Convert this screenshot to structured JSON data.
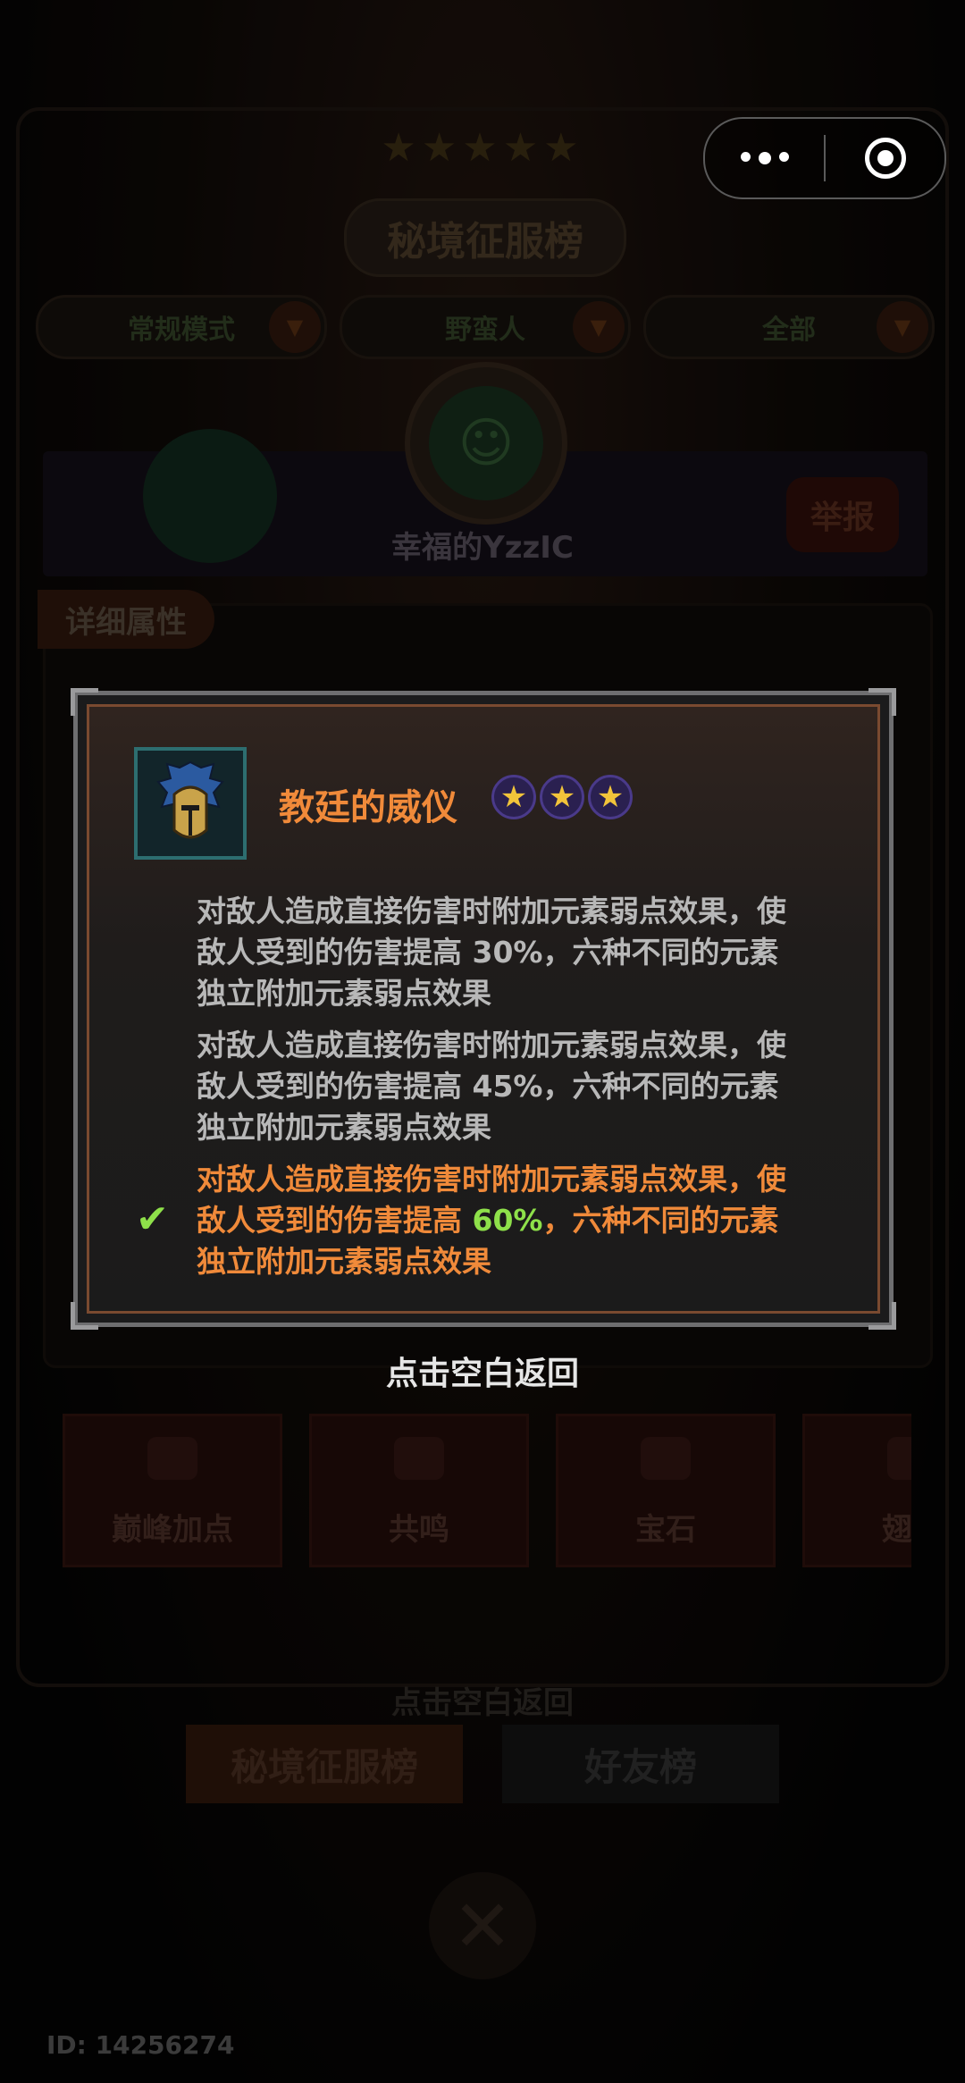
{
  "capsule": {
    "more_icon": "more-dots-icon",
    "close_icon": "target-circle-icon"
  },
  "header": {
    "title": "秘境征服榜",
    "filters": [
      {
        "label": "常规模式"
      },
      {
        "label": "野蛮人"
      },
      {
        "label": "全部"
      }
    ]
  },
  "player": {
    "name": "幸福的YzzIC",
    "report_label": "举报"
  },
  "detail": {
    "tab_label": "详细属性"
  },
  "features": [
    {
      "label": "巅峰加点"
    },
    {
      "label": "共鸣"
    },
    {
      "label": "宝石"
    },
    {
      "label": "翅膀"
    }
  ],
  "background": {
    "return_hint": "点击空白返回",
    "tabs": [
      {
        "label": "秘境征服榜"
      },
      {
        "label": "好友榜"
      }
    ]
  },
  "modal": {
    "item_name": "教廷的威仪",
    "star_count": 3,
    "effects": [
      {
        "line1": "对敌人造成直接伤害时附加元素弱点效果，使",
        "line2_pre": "敌人受到的伤害提高 ",
        "value": "30%",
        "line2_post": "，六种不同的元素",
        "line3": "独立附加元素弱点效果",
        "active": false
      },
      {
        "line1": "对敌人造成直接伤害时附加元素弱点效果，使",
        "line2_pre": "敌人受到的伤害提高 ",
        "value": "45%",
        "line2_post": "，六种不同的元素",
        "line3": "独立附加元素弱点效果",
        "active": false
      },
      {
        "line1": "对敌人造成直接伤害时附加元素弱点效果，使",
        "line2_pre": "敌人受到的伤害提高 ",
        "value": "60%",
        "line2_post": "，六种不同的元素",
        "line3": "独立附加元素弱点效果",
        "active": true
      }
    ]
  },
  "return_hint": "点击空白返回",
  "footer": {
    "id_text": "ID: 14256274"
  },
  "colors": {
    "accent_orange": "#f08a3a",
    "value_green": "#8ee04a",
    "text_gray": "#b8b8b8"
  }
}
